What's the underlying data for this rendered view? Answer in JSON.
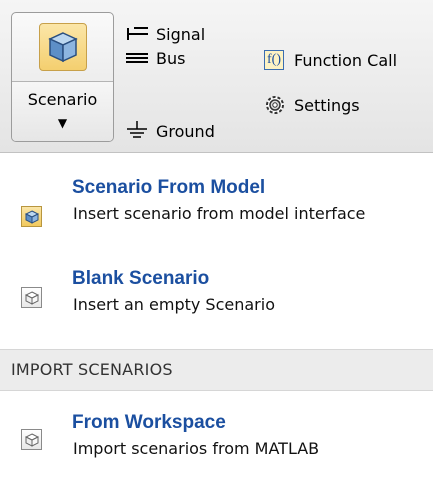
{
  "toolstrip": {
    "scenario_button": {
      "label": "Scenario",
      "icon": "cube-icon",
      "caret": "▼"
    },
    "items": {
      "signal": {
        "label": "Signal",
        "icon": "signal-icon"
      },
      "bus": {
        "label": "Bus",
        "icon": "bus-icon"
      },
      "ground": {
        "label": "Ground",
        "icon": "ground-icon"
      },
      "function_call": {
        "label": "Function Call",
        "icon": "function-call-icon",
        "glyph": "f()"
      },
      "settings": {
        "label": "Settings",
        "icon": "gear-icon"
      }
    }
  },
  "menu": {
    "items": [
      {
        "title": "Scenario From Model",
        "description": "Insert scenario from model interface",
        "icon": "scenario-model-icon"
      },
      {
        "title": "Blank Scenario",
        "description": "Insert an empty Scenario",
        "icon": "scenario-blank-icon"
      }
    ],
    "section_header": "IMPORT SCENARIOS",
    "import_items": [
      {
        "title": "From Workspace",
        "description": "Import scenarios from MATLAB",
        "icon": "workspace-icon"
      }
    ]
  },
  "colors": {
    "accent_title": "#1b4fa0",
    "icon_highlight": "#f4cf6f",
    "section_bg": "#ececec"
  }
}
